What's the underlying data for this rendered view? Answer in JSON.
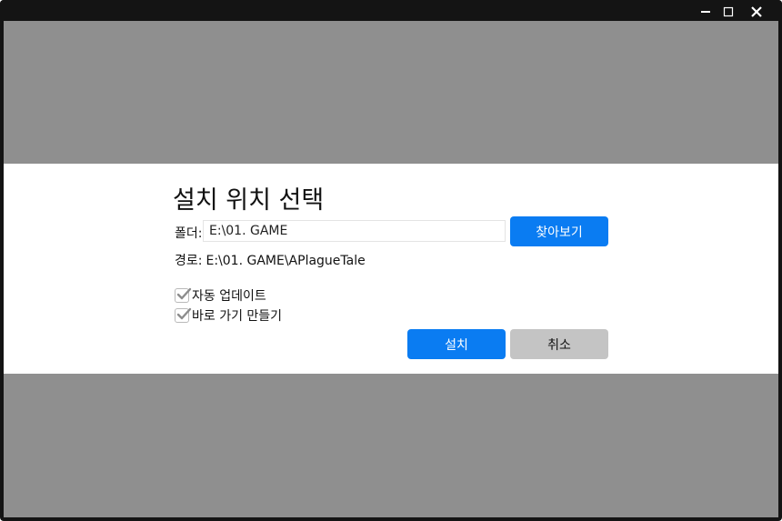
{
  "window": {
    "controls": {
      "minimize_icon": "minimize-icon",
      "maximize_icon": "maximize-icon",
      "close_icon": "close-icon"
    }
  },
  "dialog": {
    "title": "설치 위치 선택",
    "folder": {
      "label": "폴더:",
      "value": "E:\\01. GAME"
    },
    "browse_button": "찾아보기",
    "path": {
      "label": "경로:",
      "value": "E:\\01. GAME\\APlagueTale"
    },
    "options": [
      {
        "label": "자동 업데이트",
        "checked": true
      },
      {
        "label": "바로 가기 만들기",
        "checked": true
      }
    ],
    "install_button": "설치",
    "cancel_button": "취소"
  },
  "colors": {
    "primary": "#0a7cf2",
    "secondary": "#c4c4c4",
    "backdrop": "#8f8f8f",
    "titlebar": "#141414"
  }
}
